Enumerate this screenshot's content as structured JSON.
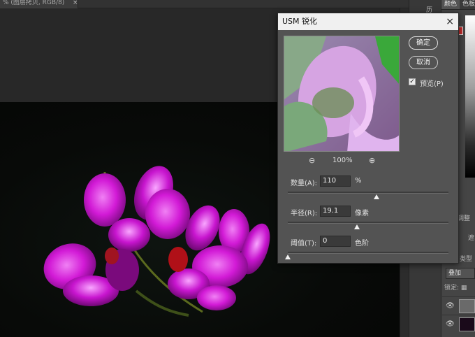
{
  "document": {
    "tab_label": "% (图层拷贝, RGB/8)",
    "tab_close": "×"
  },
  "right_panel": {
    "tabs": [
      "颜色",
      "色板"
    ],
    "panel_icon": "历",
    "adjust_label": "调整",
    "adjust_label2": "遮",
    "type_label": "类型",
    "blend_mode": "叠加",
    "lock_label": "锁定:",
    "layers": [
      {
        "eye_icon": "eye-icon",
        "visible": true
      },
      {
        "eye_icon": "eye-icon",
        "visible": true
      }
    ]
  },
  "dialog": {
    "title": "USM 锐化",
    "close": "×",
    "ok_label": "确定",
    "cancel_label": "取消",
    "preview_label": "预览(P)",
    "preview_checked": true,
    "zoom_percent": "100%",
    "zoom_out_icon": "zoom-out-icon",
    "zoom_in_icon": "zoom-in-icon",
    "params": {
      "amount": {
        "label": "数量(A):",
        "value": "110",
        "unit": "%",
        "level": 0.55
      },
      "radius": {
        "label": "半径(R):",
        "value": "19.1",
        "unit": "像素",
        "level": 0.43
      },
      "threshold": {
        "label": "阈值(T):",
        "value": "0",
        "unit": "色阶",
        "level": 0.0
      }
    }
  },
  "colors": {
    "dialog_bg": "#535353",
    "title_bar": "#f0f0f0",
    "accent_red": "#c42d2d",
    "flower": "#d21ad6"
  }
}
